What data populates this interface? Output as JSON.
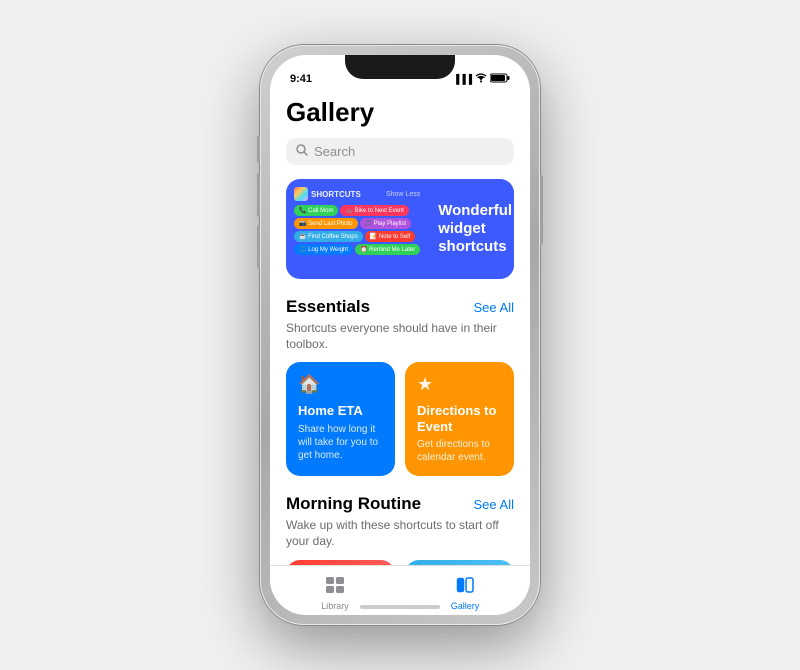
{
  "phone": {
    "status_bar": {
      "time": "9:41",
      "signal": "●●●",
      "wifi": "WiFi",
      "battery": "Battery"
    }
  },
  "header": {
    "title": "Gallery"
  },
  "search": {
    "placeholder": "Search"
  },
  "hero": {
    "brand_label": "SHORTCUTS",
    "show_label": "Show Less",
    "text": "Wonderful widget shortcuts",
    "pills": [
      {
        "label": "Call Mom",
        "color": "green"
      },
      {
        "label": "Bike to Next Event",
        "color": "pink"
      },
      {
        "label": "Send Last Photo",
        "color": "orange"
      },
      {
        "label": "Play Playlist",
        "color": "purple"
      },
      {
        "label": "Find Coffee Shops",
        "color": "teal"
      },
      {
        "label": "Note to Self",
        "color": "red"
      },
      {
        "label": "Log My Weight",
        "color": "blue"
      },
      {
        "label": "Remind Me Later",
        "color": "green"
      }
    ]
  },
  "sections": [
    {
      "id": "essentials",
      "title": "Essentials",
      "see_all": "See All",
      "description": "Shortcuts everyone should have in their toolbox.",
      "cards": [
        {
          "id": "home-eta",
          "icon": "🏠",
          "title": "Home ETA",
          "description": "Share how long it will take for you to get home.",
          "color": "blue"
        },
        {
          "id": "directions-event",
          "icon": "★",
          "title": "Directions to Event",
          "description": "Get directions to calendar event.",
          "color": "orange"
        }
      ]
    },
    {
      "id": "morning-routine",
      "title": "Morning Routine",
      "see_all": "See All",
      "description": "Wake up with these shortcuts to start off your day."
    }
  ],
  "tab_bar": {
    "tabs": [
      {
        "id": "library",
        "label": "Library",
        "icon": "⊞",
        "active": false
      },
      {
        "id": "gallery",
        "label": "Gallery",
        "icon": "⊟",
        "active": true
      }
    ]
  }
}
